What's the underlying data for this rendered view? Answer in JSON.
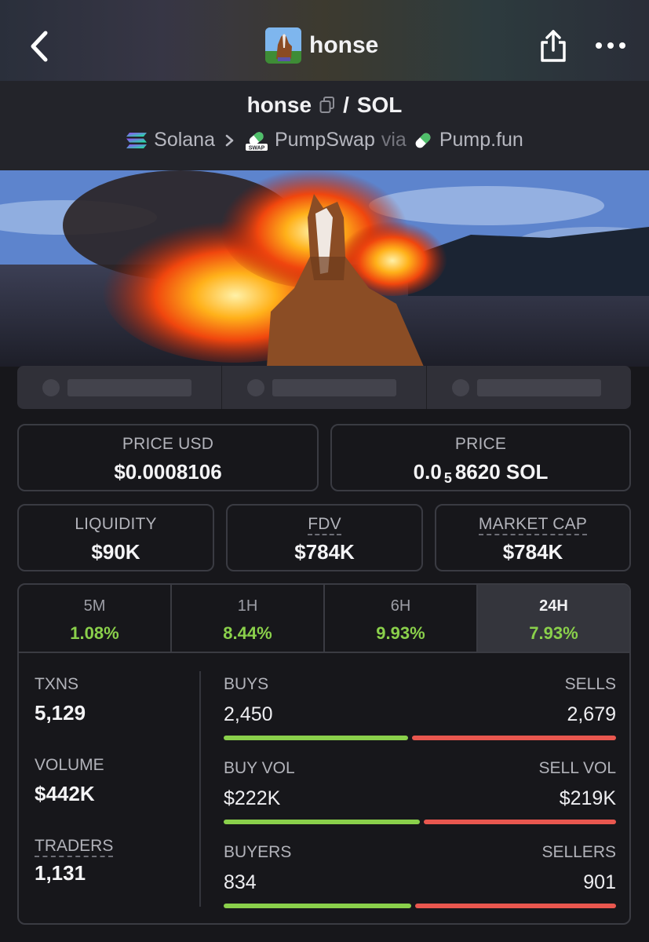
{
  "header": {
    "title": "honse",
    "icons": [
      "back-chevron-icon",
      "share-icon",
      "more-icon"
    ]
  },
  "pair": {
    "base": "honse",
    "separator": "/",
    "quote": "SOL",
    "chain": "Solana",
    "dex": "PumpSwap",
    "via_label": "via",
    "launchpad": "Pump.fun"
  },
  "prices": {
    "price_usd_label": "PRICE USD",
    "price_usd": "$0.0008106",
    "price_label": "PRICE",
    "price_prefix": "0.0",
    "price_zeros": "5",
    "price_suffix": "8620 SOL"
  },
  "metrics": {
    "liquidity_label": "LIQUIDITY",
    "liquidity": "$90K",
    "fdv_label": "FDV",
    "fdv": "$784K",
    "mcap_label": "MARKET CAP",
    "mcap": "$784K"
  },
  "timeframes": [
    {
      "label": "5M",
      "change": "1.08%"
    },
    {
      "label": "1H",
      "change": "8.44%"
    },
    {
      "label": "6H",
      "change": "9.93%"
    },
    {
      "label": "24H",
      "change": "7.93%",
      "active": true
    }
  ],
  "stats": {
    "txns_label": "TXNS",
    "txns": "5,129",
    "volume_label": "VOLUME",
    "volume": "$442K",
    "traders_label": "TRADERS",
    "traders": "1,131",
    "buys_label": "BUYS",
    "buys": "2,450",
    "sells_label": "SELLS",
    "sells": "2,679",
    "buy_vol_label": "BUY VOL",
    "buy_vol": "$222K",
    "sell_vol_label": "SELL VOL",
    "sell_vol": "$219K",
    "buyers_label": "BUYERS",
    "buyers": "834",
    "sellers_label": "SELLERS",
    "sellers": "901"
  },
  "colors": {
    "positive": "#8ad04b",
    "negative": "#e9574f",
    "background": "#17171b"
  }
}
